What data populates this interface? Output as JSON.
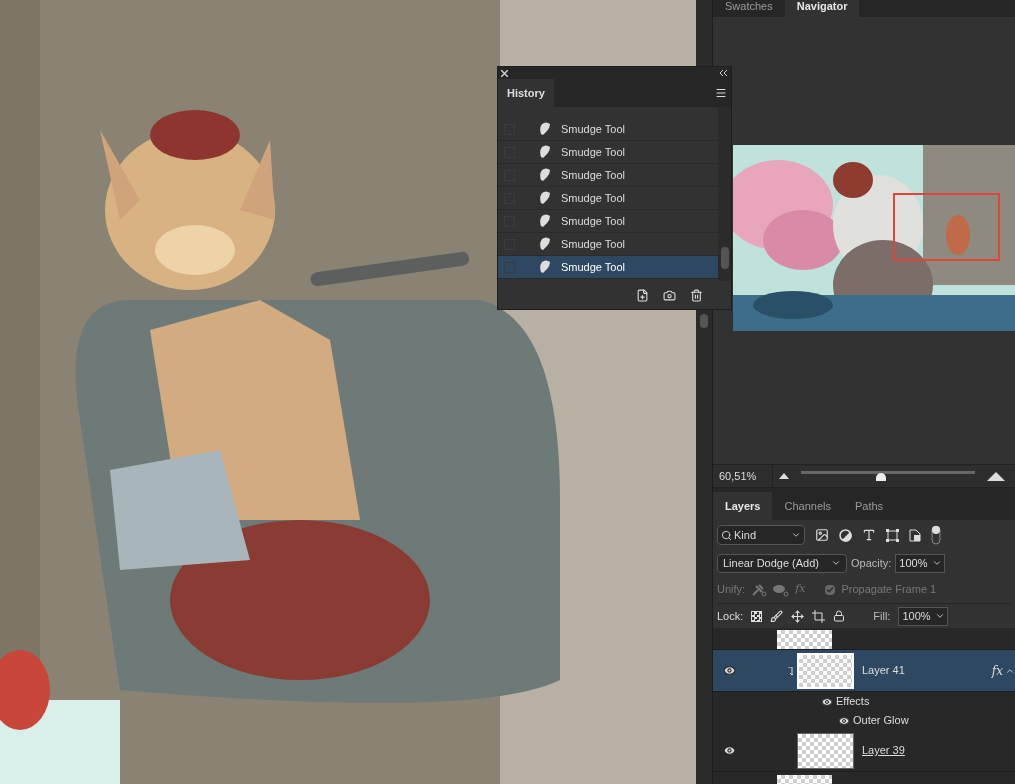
{
  "navigator_panel": {
    "tabs": [
      {
        "label": "Swatches",
        "selected": false
      },
      {
        "label": "Navigator",
        "selected": true
      }
    ],
    "zoom": "60,51%",
    "zoom_slider": {
      "level": 0.46
    }
  },
  "history_panel": {
    "title": "History",
    "states": [
      {
        "label": "Smudge Tool",
        "selected": false
      },
      {
        "label": "Smudge Tool",
        "selected": false
      },
      {
        "label": "Smudge Tool",
        "selected": false
      },
      {
        "label": "Smudge Tool",
        "selected": false
      },
      {
        "label": "Smudge Tool",
        "selected": false
      },
      {
        "label": "Smudge Tool",
        "selected": false
      },
      {
        "label": "Smudge Tool",
        "selected": true
      }
    ]
  },
  "layers_panel": {
    "tabs": [
      {
        "label": "Layers",
        "selected": true
      },
      {
        "label": "Channels",
        "selected": false
      },
      {
        "label": "Paths",
        "selected": false
      }
    ],
    "filter": "Kind",
    "blend_mode": "Linear Dodge (Add)",
    "opacity_label": "Opacity:",
    "opacity": "100%",
    "unify_label": "Unify:",
    "unify_fx": "fx",
    "propagate": {
      "label": "Propagate Frame 1",
      "checked": true
    },
    "lock_label": "Lock:",
    "fill_label": "Fill:",
    "fill": "100%",
    "layers": [
      {
        "name": "Layer 41",
        "selected": true,
        "visible": true,
        "clipped": true,
        "fx": "fx",
        "effects": [
          {
            "label": "Effects"
          },
          {
            "label": "Outer Glow"
          }
        ]
      },
      {
        "name": "Layer 39",
        "selected": false,
        "visible": true,
        "clipped": false
      }
    ]
  }
}
